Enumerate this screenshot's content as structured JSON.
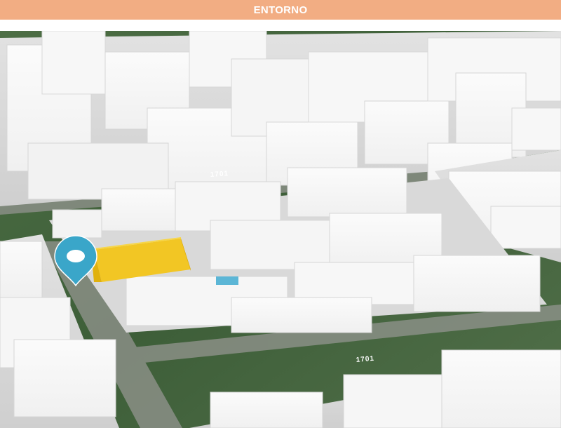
{
  "header": {
    "title": "ENTORNO",
    "background": "#f2ad83",
    "text_color": "#ffffff"
  },
  "map": {
    "view": "3D aerial city blocks",
    "street_number_labels": [
      "1701",
      "1701"
    ],
    "highlighted_building_color": "#f2c624",
    "pin": {
      "icon": "location-pin-icon",
      "color": "#3aa6c9"
    },
    "building_color": "#eeeeee",
    "vegetation_color": "#3f6b3a"
  }
}
